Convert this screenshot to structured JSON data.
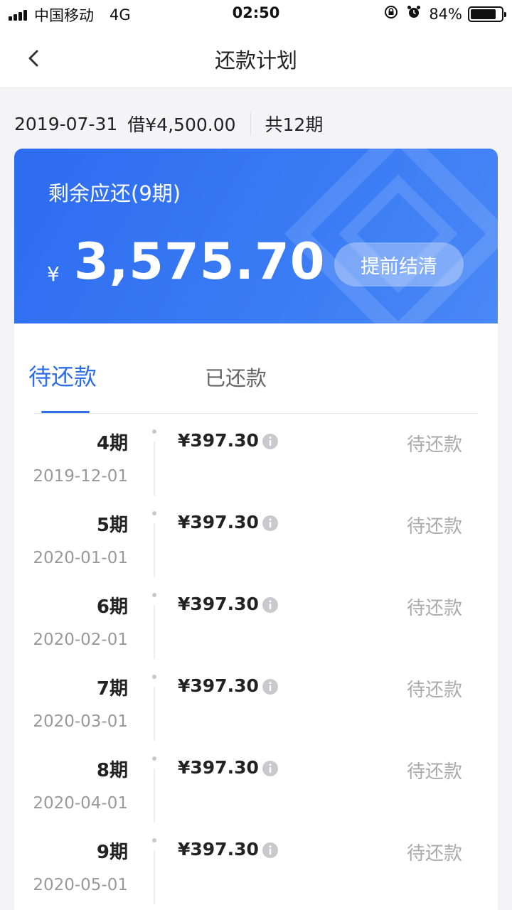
{
  "status_bar": {
    "carrier": "中国移动",
    "network": "4G",
    "time": "02:50",
    "battery_percent": "84%",
    "battery_level": 0.84
  },
  "nav": {
    "title": "还款计划",
    "back_icon": "chevron-left-icon"
  },
  "loan": {
    "date": "2019-07-31",
    "borrowed": "借¥4,500.00",
    "total_periods": "共12期"
  },
  "summary": {
    "label": "剩余应还(9期)",
    "currency": "¥",
    "amount": "3,575.70",
    "prepay_label": "提前结清"
  },
  "tabs": {
    "pending": "待还款",
    "paid": "已还款"
  },
  "installments": [
    {
      "period": "4期",
      "date": "2019-12-01",
      "amount": "¥397.30",
      "status": "待还款"
    },
    {
      "period": "5期",
      "date": "2020-01-01",
      "amount": "¥397.30",
      "status": "待还款"
    },
    {
      "period": "6期",
      "date": "2020-02-01",
      "amount": "¥397.30",
      "status": "待还款"
    },
    {
      "period": "7期",
      "date": "2020-03-01",
      "amount": "¥397.30",
      "status": "待还款"
    },
    {
      "period": "8期",
      "date": "2020-04-01",
      "amount": "¥397.30",
      "status": "待还款"
    },
    {
      "period": "9期",
      "date": "2020-05-01",
      "amount": "¥397.30",
      "status": "待还款"
    }
  ],
  "colors": {
    "accent": "#2e6de8",
    "card": "#3a7cf5",
    "muted": "#aaaaaa"
  }
}
